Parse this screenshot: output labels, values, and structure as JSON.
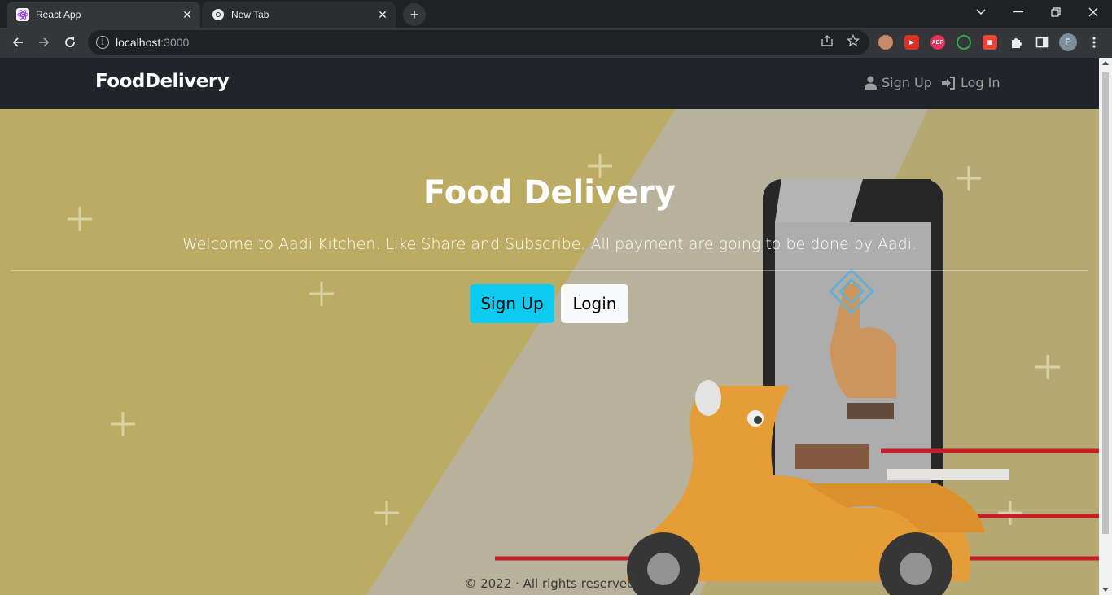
{
  "browser": {
    "tabs": [
      {
        "title": "React App",
        "active": true,
        "icon": "react-icon"
      },
      {
        "title": "New Tab",
        "active": false,
        "icon": "chrome-icon"
      }
    ],
    "url_host": "localhost",
    "url_port": ":3000",
    "profile_initial": "P"
  },
  "app": {
    "brand": "FoodDelivery",
    "nav": {
      "signup": "Sign Up",
      "login": "Log In"
    },
    "hero": {
      "title": "Food Delivery",
      "lead": "Welcome to Aadi Kitchen. Like Share and Subscribe. All payment are going to be done by Aadi.",
      "signup_button": "Sign Up",
      "login_button": "Login"
    },
    "footer": "© 2022 · All rights reserved"
  },
  "colors": {
    "navbar": "#212529",
    "hero_bg": "#b8a659",
    "btn_info": "#0dcaf0",
    "btn_light": "#f8f9fa"
  }
}
